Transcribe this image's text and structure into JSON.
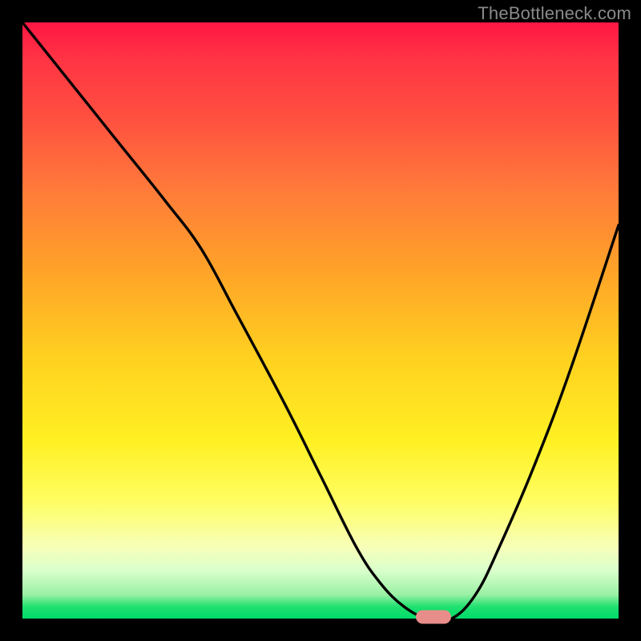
{
  "watermark": "TheBottleneck.com",
  "colors": {
    "curve": "#000000",
    "marker": "#e88d8a",
    "gradient_top": "#ff1744",
    "gradient_mid": "#ffd020",
    "gradient_bottom": "#00dc6a"
  },
  "chart_data": {
    "type": "line",
    "title": "",
    "xlabel": "",
    "ylabel": "",
    "xlim": [
      0,
      100
    ],
    "ylim": [
      0,
      100
    ],
    "x": [
      0,
      8,
      16,
      24,
      30,
      36,
      44,
      50,
      56,
      60,
      64,
      68,
      72,
      76,
      80,
      86,
      92,
      100
    ],
    "values": [
      100,
      90,
      80,
      70,
      62,
      51,
      36,
      24,
      12,
      6,
      2,
      0,
      0,
      4,
      12,
      26,
      42,
      66
    ],
    "marker": {
      "x": 69,
      "y": 0
    },
    "note": "x,y are percentages of the plot area; y=0 is the bottom (green), y=100 is the top (red)."
  }
}
